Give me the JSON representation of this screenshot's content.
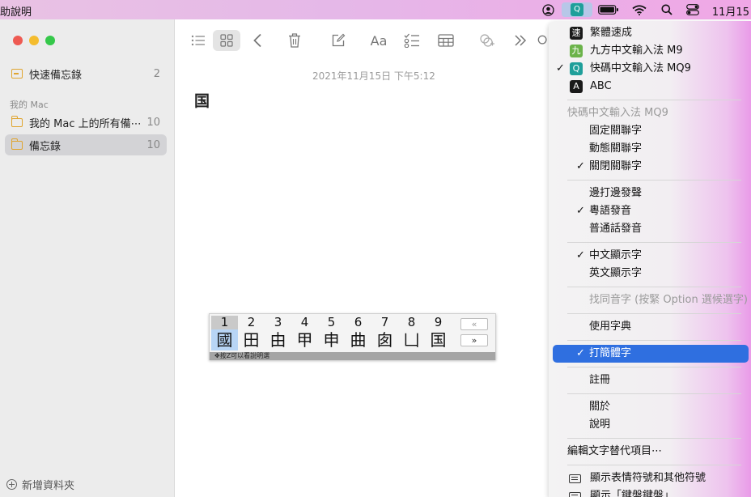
{
  "menubar": {
    "app_help": "助說明",
    "clock": "11月15"
  },
  "sidebar": {
    "quick_notes": {
      "label": "快速備忘錄",
      "count": "2"
    },
    "section_title": "我的 Mac",
    "folders": [
      {
        "label": "我的 Mac 上的所有備⋯",
        "count": "10"
      },
      {
        "label": "備忘錄",
        "count": "10"
      }
    ],
    "new_folder": "新增資料夾"
  },
  "note": {
    "date": "2021年11月15日 下午5:12",
    "body": "国"
  },
  "candidates": {
    "numbers": [
      "1",
      "2",
      "3",
      "4",
      "5",
      "6",
      "7",
      "8",
      "9"
    ],
    "chars": [
      "國",
      "田",
      "由",
      "甲",
      "申",
      "曲",
      "囱",
      "凵",
      "国"
    ],
    "prev": "«",
    "next": "»",
    "footer": "✥按Z可以看說明選"
  },
  "menu": {
    "input_sources": [
      {
        "label": "繁體速成",
        "badge": "速",
        "color": "#1a1a1a",
        "checked": false
      },
      {
        "label": "九方中文輸入法 M9",
        "badge": "九",
        "color": "#6bb34a",
        "checked": false
      },
      {
        "label": "快碼中文輸入法 MQ9",
        "badge": "Q",
        "color": "#1f9f9a",
        "checked": true
      },
      {
        "label": "ABC",
        "badge": "A",
        "color": "#1a1a1a",
        "checked": false
      }
    ],
    "ime_header": "快碼中文輸入法 MQ9",
    "assoc": [
      "固定關聯字",
      "動態關聯字",
      "關閉關聯字"
    ],
    "speech": [
      "邊打邊發聲",
      "粵語發音",
      "普通話發音"
    ],
    "display": [
      "中文顯示字",
      "英文顯示字"
    ],
    "homophone": "找同音字 (按緊 Option 選候選字)",
    "dictionary": "使用字典",
    "simplified": "打簡體字",
    "register": "註冊",
    "about": "關於",
    "help": "說明",
    "edit_replace": "編輯文字替代項目⋯",
    "emoji": "顯示表情符號和其他符號",
    "keyboard_viewer": "顯示「鍵盤鍵盤」",
    "checkmark": "✓"
  }
}
